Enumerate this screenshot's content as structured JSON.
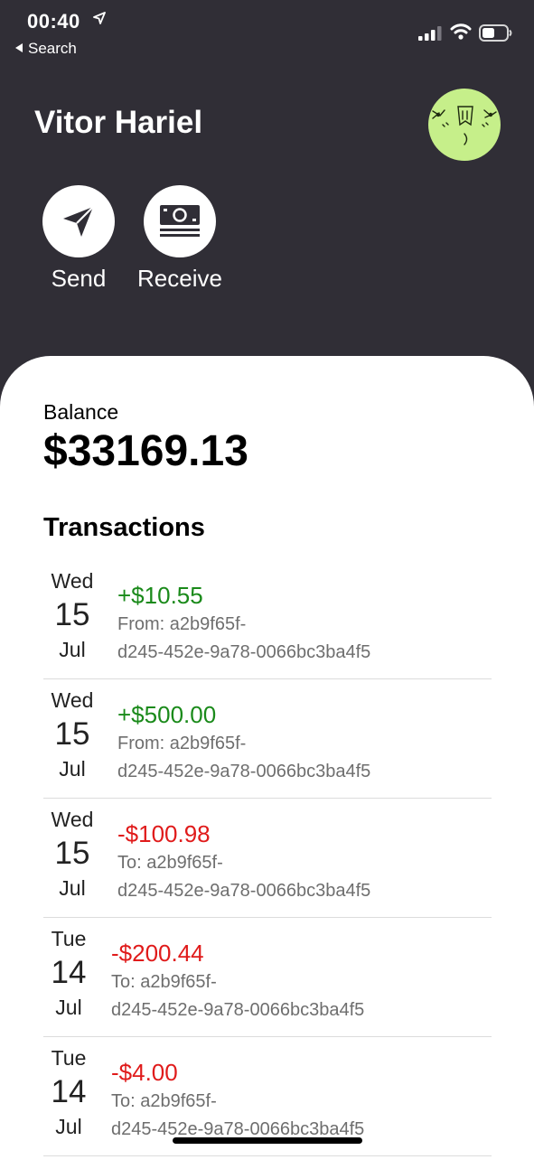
{
  "status_bar": {
    "time": "00:40",
    "back_label": "Search"
  },
  "header": {
    "user_name": "Vitor Hariel"
  },
  "actions": [
    {
      "label": "Send",
      "icon": "paper-plane-icon"
    },
    {
      "label": "Receive",
      "icon": "banknote-icon"
    }
  ],
  "balance": {
    "label": "Balance",
    "value": "$33169.13"
  },
  "transactions": {
    "heading": "Transactions",
    "items": [
      {
        "weekday": "Wed",
        "day": "15",
        "month": "Jul",
        "amount": "+$10.55",
        "direction": "in",
        "party_line1": "From: a2b9f65f-",
        "party_line2": "d245-452e-9a78-0066bc3ba4f5"
      },
      {
        "weekday": "Wed",
        "day": "15",
        "month": "Jul",
        "amount": "+$500.00",
        "direction": "in",
        "party_line1": "From: a2b9f65f-",
        "party_line2": "d245-452e-9a78-0066bc3ba4f5"
      },
      {
        "weekday": "Wed",
        "day": "15",
        "month": "Jul",
        "amount": "-$100.98",
        "direction": "out",
        "party_line1": "To: a2b9f65f-",
        "party_line2": "d245-452e-9a78-0066bc3ba4f5"
      },
      {
        "weekday": "Tue",
        "day": "14",
        "month": "Jul",
        "amount": "-$200.44",
        "direction": "out",
        "party_line1": "To: a2b9f65f-",
        "party_line2": "d245-452e-9a78-0066bc3ba4f5"
      },
      {
        "weekday": "Tue",
        "day": "14",
        "month": "Jul",
        "amount": "-$4.00",
        "direction": "out",
        "party_line1": "To: a2b9f65f-",
        "party_line2": "d245-452e-9a78-0066bc3ba4f5"
      }
    ]
  },
  "colors": {
    "header_bg": "#302e36",
    "avatar_bg": "#c6ef8a",
    "positive": "#1a8a1a",
    "negative": "#e01b1b"
  }
}
